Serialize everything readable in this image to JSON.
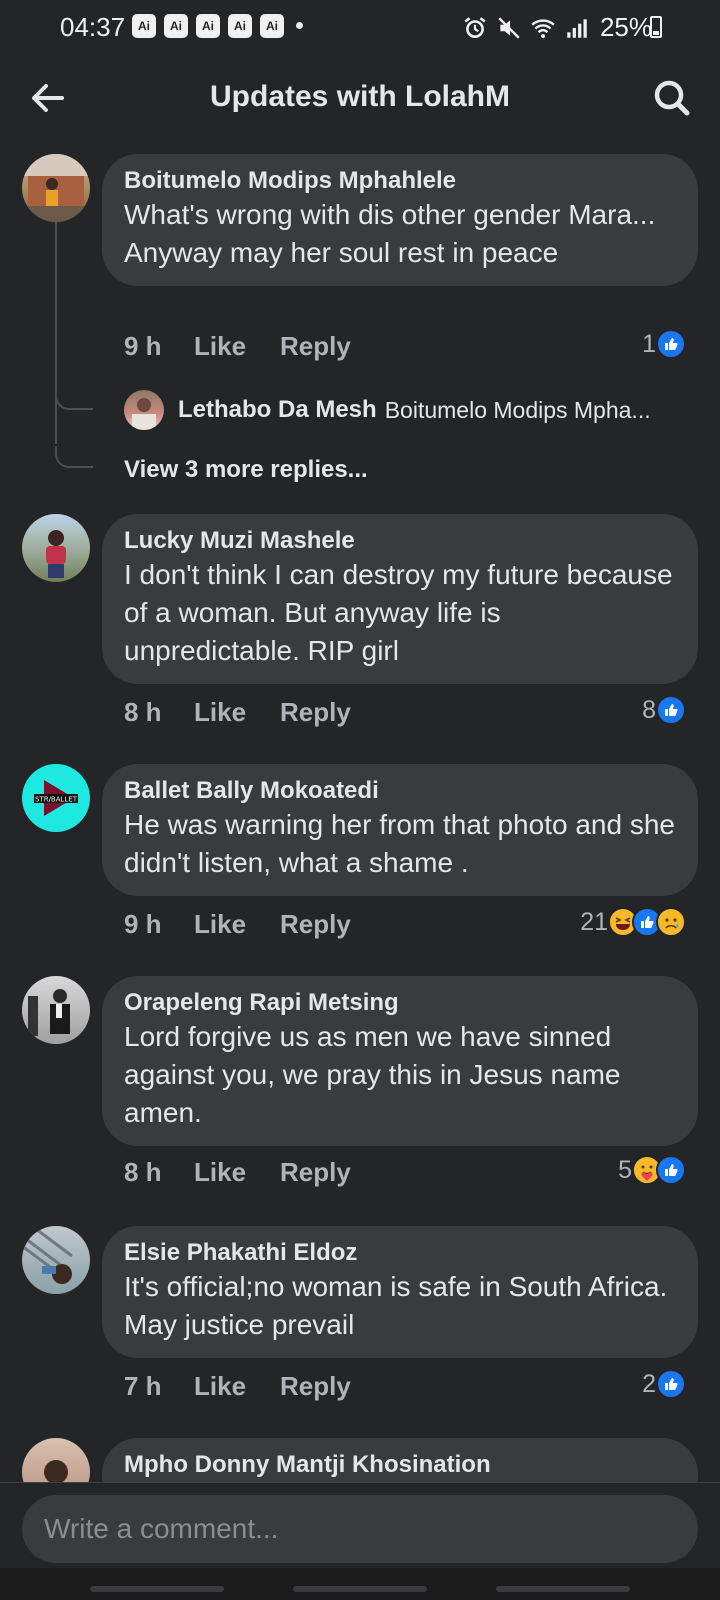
{
  "status_bar": {
    "time": "04:37",
    "badges": [
      "Ai",
      "Ai",
      "Ai",
      "Ai",
      "Ai"
    ],
    "battery": "25%",
    "icons": [
      "alarm-icon",
      "mute-icon",
      "wifi-icon",
      "signal-icon",
      "battery-icon"
    ]
  },
  "header": {
    "title": "Updates with LolahM",
    "back_icon": "arrow-left-icon",
    "search_icon": "search-icon"
  },
  "actions": {
    "like": "Like",
    "reply": "Reply"
  },
  "comments": [
    {
      "author": "Boitumelo Modips Mphahlele",
      "text": "What's wrong with dis other gender Mara... Anyway may her soul rest in peace",
      "time": "9 h",
      "reaction_count": "1",
      "reactions": [
        "like"
      ],
      "reply_preview": {
        "author": "Lethabo Da Mesh",
        "text": "Boitumelo Modips Mpha..."
      },
      "view_more": "View 3 more replies..."
    },
    {
      "author": "Lucky Muzi Mashele",
      "text": "I don't think I can destroy my future because of a woman. But anyway life is unpredictable. RIP girl",
      "time": "8 h",
      "reaction_count": "8",
      "reactions": [
        "like"
      ]
    },
    {
      "author": "Ballet Bally Mokoatedi",
      "text": "He was warning her from that photo and she didn't listen, what a shame .",
      "time": "9 h",
      "reaction_count": "21",
      "reactions": [
        "haha",
        "like",
        "sad"
      ]
    },
    {
      "author": "Orapeleng Rapi Metsing",
      "text": "Lord forgive us as men we have sinned against you, we pray this in Jesus name amen.",
      "time": "8 h",
      "reaction_count": "5",
      "reactions": [
        "care",
        "like"
      ]
    },
    {
      "author": "Elsie Phakathi Eldoz",
      "text": "It's official;no woman is safe in South Africa. May justice prevail",
      "time": "7 h",
      "reaction_count": "2",
      "reactions": [
        "like"
      ]
    },
    {
      "author": "Mpho Donny Mantji Khosination"
    }
  ],
  "composer": {
    "placeholder": "Write a comment..."
  },
  "colors": {
    "background": "#242526",
    "bubble": "#3a3b3c",
    "text": "#e4e6eb",
    "secondary_text": "#b0b3b8",
    "like_blue": "#1877f2",
    "avatar_ballet_bg": "#1de9e0"
  }
}
